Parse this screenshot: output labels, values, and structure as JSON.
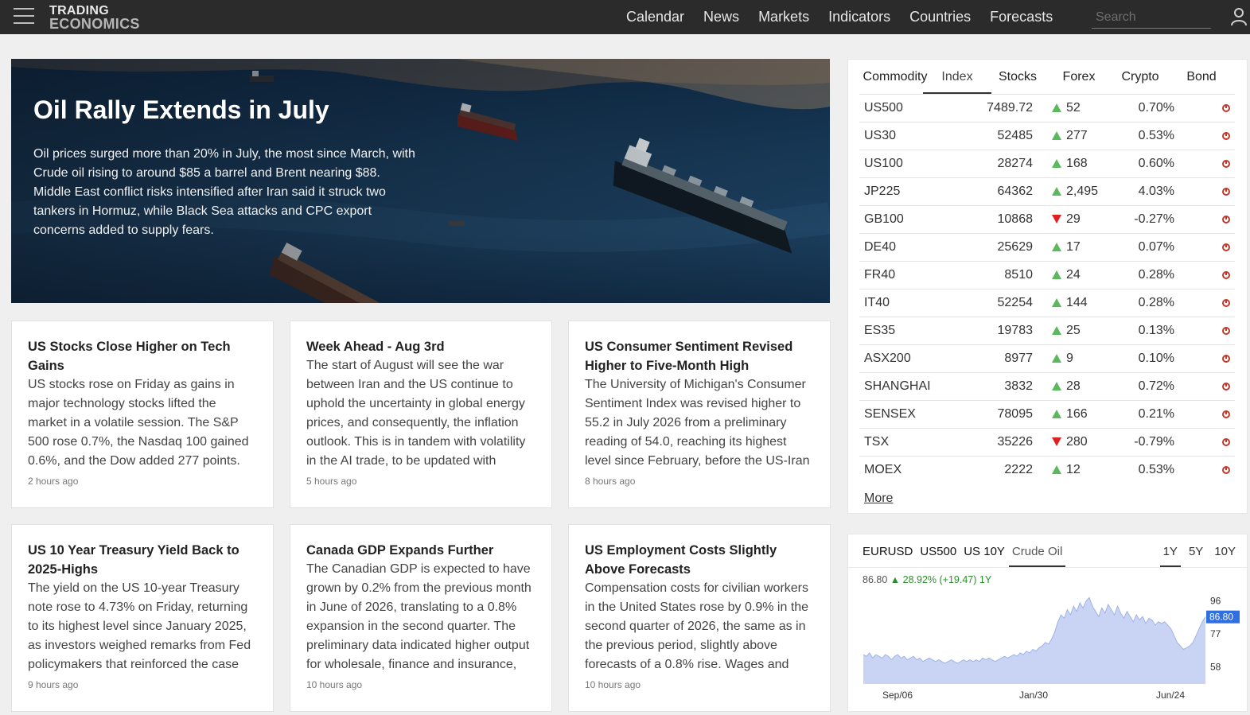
{
  "logo": {
    "line1": "TRADING",
    "line2": "ECONOMICS"
  },
  "nav": [
    "Calendar",
    "News",
    "Markets",
    "Indicators",
    "Countries",
    "Forecasts"
  ],
  "search": {
    "placeholder": "Search"
  },
  "hero": {
    "title": "Oil Rally Extends in July",
    "text": "Oil prices surged more than 20% in July, the most since March, with Crude oil rising to around $85 a barrel and Brent nearing $88. Middle East conflict risks intensified after Iran said it struck two tankers in Hormuz, while Black Sea attacks and CPC export concerns added to supply fears."
  },
  "cards": [
    {
      "title": "US Stocks Close Higher on Tech Gains",
      "body": "US stocks rose on Friday as gains in major technology stocks lifted the market in a volatile session. The S&P 500 rose 0.7%, the Nasdaq 100 gained 0.6%, and the Dow added 277 points.",
      "time": "2 hours ago"
    },
    {
      "title": "Week Ahead - Aug 3rd",
      "body": "The start of August will see the war between Iran and the US continue to uphold the uncertainty in global energy prices, and consequently, the inflation outlook. This is in tandem with volatility in the AI trade, to be updated with",
      "time": "5 hours ago"
    },
    {
      "title": "US Consumer Sentiment Revised Higher to Five-Month High",
      "body": "The University of Michigan's Consumer Sentiment Index was revised higher to 55.2 in July 2026 from a preliminary reading of 54.0, reaching its highest level since February, before the US-Iran",
      "time": "8 hours ago"
    },
    {
      "title": "US 10 Year Treasury Yield Back to 2025-Highs",
      "body": "The yield on the US 10-year Treasury note rose to 4.73% on Friday, returning to its highest level since January 2025, as investors weighed remarks from Fed policymakers that reinforced the case",
      "time": "9 hours ago"
    },
    {
      "title": "Canada GDP Expands Further",
      "body": "The Canadian GDP is expected to have grown by 0.2% from the previous month in June of 2026, translating to a 0.8% expansion in the second quarter. The preliminary data indicated higher output for wholesale, finance and insurance,",
      "time": "10 hours ago"
    },
    {
      "title": "US Employment Costs Slightly Above Forecasts",
      "body": "Compensation costs for civilian workers in the United States rose by 0.9% in the second quarter of 2026, the same as in the previous period, slightly above forecasts of a 0.8% rise. Wages and",
      "time": "10 hours ago"
    }
  ],
  "market_tabs": [
    "Commodity",
    "Index",
    "Stocks",
    "Forex",
    "Crypto",
    "Bond"
  ],
  "market_active_tab": "Index",
  "market_rows": [
    {
      "symbol": "US500",
      "price": "7489.72",
      "dir": "up",
      "change": "52",
      "pct": "0.70%"
    },
    {
      "symbol": "US30",
      "price": "52485",
      "dir": "up",
      "change": "277",
      "pct": "0.53%"
    },
    {
      "symbol": "US100",
      "price": "28274",
      "dir": "up",
      "change": "168",
      "pct": "0.60%"
    },
    {
      "symbol": "JP225",
      "price": "64362",
      "dir": "up",
      "change": "2,495",
      "pct": "4.03%"
    },
    {
      "symbol": "GB100",
      "price": "10868",
      "dir": "down",
      "change": "29",
      "pct": "-0.27%"
    },
    {
      "symbol": "DE40",
      "price": "25629",
      "dir": "up",
      "change": "17",
      "pct": "0.07%"
    },
    {
      "symbol": "FR40",
      "price": "8510",
      "dir": "up",
      "change": "24",
      "pct": "0.28%"
    },
    {
      "symbol": "IT40",
      "price": "52254",
      "dir": "up",
      "change": "144",
      "pct": "0.28%"
    },
    {
      "symbol": "ES35",
      "price": "19783",
      "dir": "up",
      "change": "25",
      "pct": "0.13%"
    },
    {
      "symbol": "ASX200",
      "price": "8977",
      "dir": "up",
      "change": "9",
      "pct": "0.10%"
    },
    {
      "symbol": "SHANGHAI",
      "price": "3832",
      "dir": "up",
      "change": "28",
      "pct": "0.72%"
    },
    {
      "symbol": "SENSEX",
      "price": "78095",
      "dir": "up",
      "change": "166",
      "pct": "0.21%"
    },
    {
      "symbol": "TSX",
      "price": "35226",
      "dir": "down",
      "change": "280",
      "pct": "-0.79%"
    },
    {
      "symbol": "MOEX",
      "price": "2222",
      "dir": "up",
      "change": "12",
      "pct": "0.53%"
    }
  ],
  "more_label": "More",
  "chart_tabs": [
    "EURUSD",
    "US500",
    "US 10Y",
    "Crude Oil"
  ],
  "chart_active_tab": "Crude Oil",
  "period_tabs": [
    "1Y",
    "5Y",
    "10Y"
  ],
  "period_active": "1Y",
  "quote": {
    "last": "86.80",
    "arrow": "▲",
    "change": "28.92% (+19.47) 1Y"
  },
  "colors": {
    "up": "#2a8f2a",
    "down": "#d62020",
    "area_fill": "#c9d4f5",
    "area_line": "#9fb3ea",
    "last_badge": "#2f6fe0"
  },
  "chart_data": {
    "type": "area",
    "x_ticks": [
      "Sep/06",
      "Jan/30",
      "Jun/24"
    ],
    "y_ticks": [
      96,
      77,
      58
    ],
    "last_value_label": "86.80",
    "ylim": [
      48,
      100
    ],
    "values": [
      65,
      64,
      66,
      63,
      65,
      64,
      63,
      65,
      64,
      62,
      64,
      65,
      63,
      64,
      62,
      63,
      64,
      62,
      63,
      61,
      62,
      63,
      62,
      61,
      62,
      61,
      60,
      61,
      62,
      61,
      60,
      61,
      62,
      61,
      62,
      61,
      62,
      61,
      63,
      62,
      63,
      62,
      61,
      62,
      63,
      64,
      63,
      64,
      65,
      64,
      66,
      65,
      67,
      66,
      68,
      67,
      69,
      70,
      72,
      71,
      74,
      78,
      84,
      88,
      86,
      91,
      88,
      93,
      90,
      95,
      92,
      96,
      98,
      93,
      90,
      87,
      92,
      89,
      94,
      91,
      88,
      93,
      89,
      86,
      90,
      87,
      84,
      88,
      85,
      87,
      83,
      86,
      85,
      82,
      84,
      83,
      84,
      82,
      80,
      76,
      72,
      70,
      68,
      69,
      70,
      72,
      76,
      80,
      84,
      86.8
    ]
  },
  "icons": {
    "menu": "hamburger-icon",
    "user": "user-icon",
    "alert": "clock-icon"
  }
}
